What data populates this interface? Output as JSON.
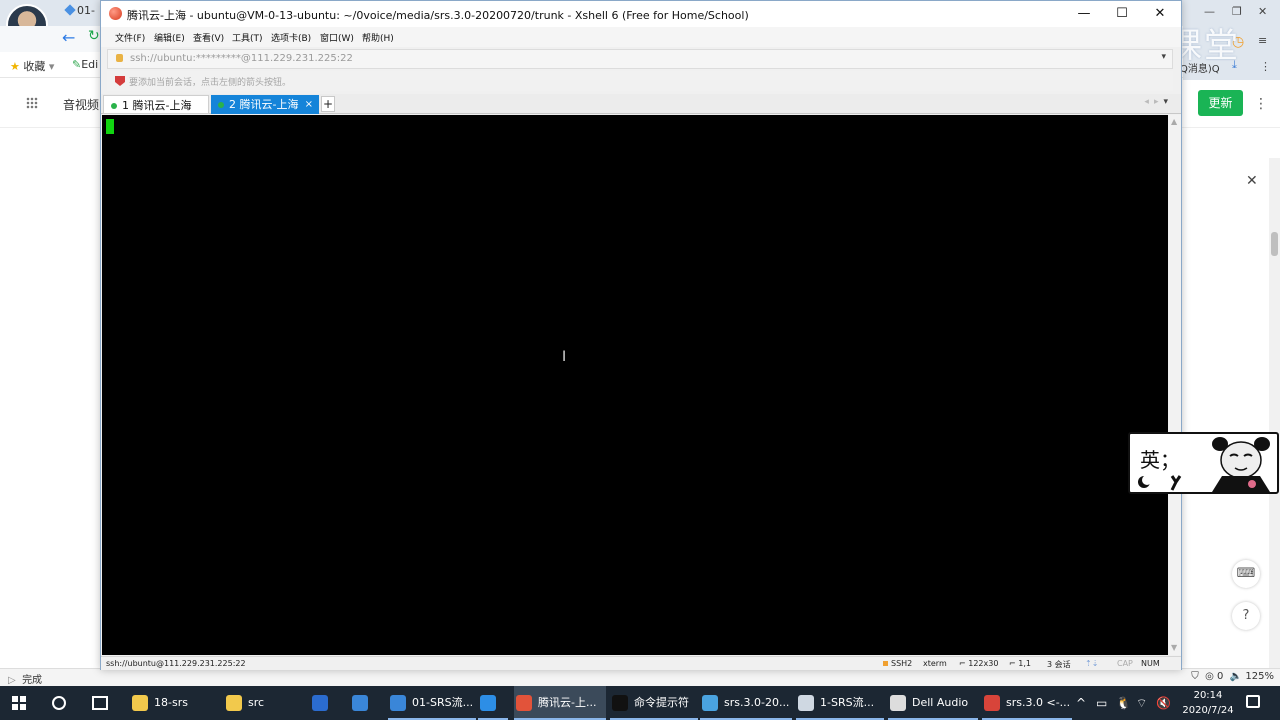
{
  "browser": {
    "tab_label": "01-",
    "bookmarks": [
      {
        "label": "收藏"
      },
      {
        "label": "Edi"
      }
    ],
    "qq_notice": "Q消息)Q",
    "app_menu_label": "音视频",
    "update_button": "更新",
    "status_left": "完成",
    "status_right": "125%"
  },
  "watermark": {
    "text": "腾讯课堂"
  },
  "xshell": {
    "title": "腾讯云-上海 - ubuntu@VM-0-13-ubuntu: ~/0voice/media/srs.3.0-20200720/trunk - Xshell 6 (Free for Home/School)",
    "menu": [
      "文件(F)",
      "编辑(E)",
      "查看(V)",
      "工具(T)",
      "选项卡(B)",
      "窗口(W)",
      "帮助(H)"
    ],
    "address": "ssh://ubuntu:*********@111.229.231.225:22",
    "tip": "要添加当前会话，点击左侧的箭头按钮。",
    "tabs": [
      {
        "label": "1 腾讯云-上海"
      },
      {
        "label": "2 腾讯云-上海"
      }
    ],
    "tab_add": "+",
    "tab2_close": "×",
    "status": {
      "connection": "ssh://ubuntu@111.229.231.225:22",
      "protocol": "SSH2",
      "terminal": "xterm",
      "size": "122x30",
      "position": "1,1",
      "sessions": "3 会话",
      "cap": "CAP",
      "num": "NUM"
    }
  },
  "sticker": {
    "text": "英；"
  },
  "taskbar": {
    "items": [
      {
        "label": "18-srs",
        "icon_color": "#f2c94c"
      },
      {
        "label": "src",
        "icon_color": "#f2c94c"
      },
      {
        "label": "",
        "icon_color": "#2b6ccf"
      },
      {
        "label": "",
        "icon_color": "#3a86d8"
      },
      {
        "label": "01-SRS流...",
        "icon_color": "#3a86d8"
      },
      {
        "label": "",
        "icon_color": "#2d8ee6"
      },
      {
        "label": "腾讯云-上...",
        "icon_color": "#e2533a"
      },
      {
        "label": "命令提示符",
        "icon_color": "#111111"
      },
      {
        "label": "srs.3.0-20...",
        "icon_color": "#4aa3e0"
      },
      {
        "label": "1-SRS流...",
        "icon_color": "#cfd8e2"
      },
      {
        "label": "Dell Audio",
        "icon_color": "#dddddd"
      },
      {
        "label": "srs.3.0 <-...",
        "icon_color": "#d8443a"
      }
    ],
    "clock_time": "20:14",
    "clock_date": "2020/7/24"
  }
}
